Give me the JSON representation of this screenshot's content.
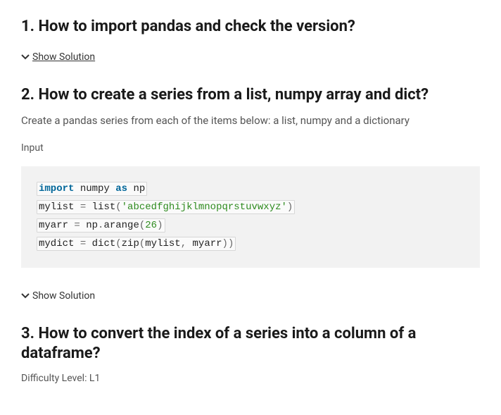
{
  "q1": {
    "heading": "1. How to import pandas and check the version?",
    "show_solution": "Show Solution"
  },
  "q2": {
    "heading": "2. How to create a series from a list, numpy array and dict?",
    "desc": "Create a pandas series from each of the items below: a list, numpy and a dictionary",
    "input_label": "Input",
    "code": {
      "l1": {
        "kw1": "import",
        "mod": "numpy",
        "kw2": "as",
        "alias": "np"
      },
      "l2": {
        "var": "mylist",
        "eq": "=",
        "fn": "list",
        "lp": "(",
        "str": "'abcedfghijklmnopqrstuvwxyz'",
        "rp": ")"
      },
      "l3": {
        "var": "myarr",
        "eq": "=",
        "obj": "np",
        "dot": ".",
        "fn": "arange",
        "lp": "(",
        "num": "26",
        "rp": ")"
      },
      "l4": {
        "var": "mydict",
        "eq": "=",
        "fn1": "dict",
        "lp1": "(",
        "fn2": "zip",
        "lp2": "(",
        "a1": "mylist",
        "comma": ",",
        "sp": " ",
        "a2": "myarr",
        "rp2": ")",
        "rp1": ")"
      }
    },
    "show_solution": "Show Solution"
  },
  "q3": {
    "heading": "3. How to convert the index of a series into a column of a dataframe?",
    "difficulty": "Difficulty Level: L1"
  }
}
